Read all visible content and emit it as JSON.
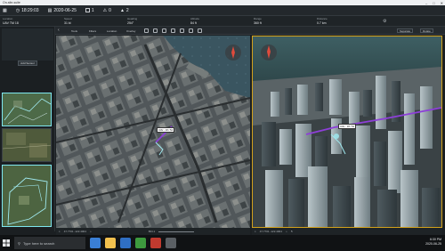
{
  "window": {
    "title": "On-site-suite"
  },
  "status": {
    "time": "18:29:03",
    "date": "2020-06-25",
    "count_a": "1",
    "count_b": "0",
    "count_c": "2"
  },
  "fields": [
    {
      "label": "Location",
      "value": "UAV TM 18"
    },
    {
      "label": "Speed",
      "value": "31 kt"
    },
    {
      "label": "Heading",
      "value": "254°"
    },
    {
      "label": "Altitude",
      "value": "84 ft"
    },
    {
      "label": "Range",
      "value": "360 ft"
    },
    {
      "label": "Distance",
      "value": "0.7 km"
    }
  ],
  "sidebar": {
    "button": "Add Sensor",
    "footer": "Show Details"
  },
  "toolbar": {
    "tabs": [
      "Tools",
      "Filters",
      "Location",
      "Overlay"
    ],
    "right_buttons": [
      "Separate",
      "Rotate"
    ]
  },
  "views": {
    "left_callout": "UAV - 18 / 54",
    "right_callout": "UAV - 18 / 54",
    "left_readout": "47.7701 -122.4004",
    "right_readout": "47.7701 -122.4004",
    "left_zoom": "864.1"
  },
  "taskbar": {
    "search_placeholder": "Type here to search",
    "time": "6:30 PM",
    "date": "2020-06-25"
  },
  "colors": {
    "frame_accent": "#d2a11b",
    "track": "#8d3fd8",
    "selection": "#7ee6ef"
  }
}
